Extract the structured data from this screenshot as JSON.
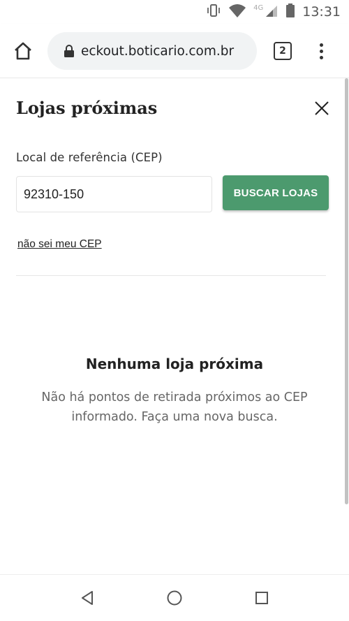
{
  "status_bar": {
    "time": "13:31",
    "network": "4G",
    "icons": [
      "vibrate-icon",
      "wifi-icon",
      "signal-icon",
      "battery-icon"
    ]
  },
  "browser": {
    "url": "eckout.boticario.com.br",
    "tab_count": "2",
    "icons": [
      "home-icon",
      "lock-icon",
      "tabs-icon",
      "menu-icon"
    ]
  },
  "panel": {
    "title": "Lojas próximas",
    "field_label": "Local de referência (CEP)",
    "cep_value": "92310-150",
    "search_button": "BUSCAR LOJAS",
    "cep_link": "não sei meu CEP",
    "empty_title": "Nenhuma loja próxima",
    "empty_message": "Não há pontos de retirada próximos ao CEP informado. Faça uma nova busca."
  },
  "colors": {
    "accent": "#4c9a6e",
    "text": "#222222",
    "muted": "#666666"
  },
  "nav_bar": {
    "icons": [
      "back-icon",
      "home-circle-icon",
      "recents-icon"
    ]
  }
}
